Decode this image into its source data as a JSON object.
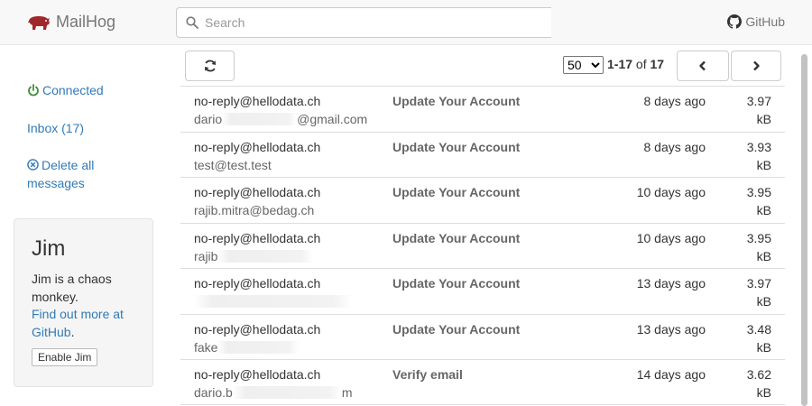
{
  "brand": {
    "name": "MailHog",
    "icon": "pig-icon",
    "color": "#a0282a"
  },
  "search": {
    "placeholder": "Search"
  },
  "header": {
    "github_label": "GitHub"
  },
  "sidebar": {
    "connected_label": "Connected",
    "inbox_label": "Inbox (17)",
    "delete_all_label": "Delete all messages",
    "jim": {
      "title": "Jim",
      "description": "Jim is a chaos monkey.",
      "link_label": "Find out more at GitHub",
      "link_suffix": ".",
      "button_label": "Enable Jim"
    }
  },
  "toolbar": {
    "per_page": "50",
    "per_page_options": [
      "50"
    ],
    "range": "1-17",
    "of": "of",
    "total": "17"
  },
  "colors": {
    "link": "#337ab7",
    "connected": "#3c8f3c",
    "border": "#dddddd"
  },
  "messages": [
    {
      "from": "no-reply@hellodata.ch",
      "to_start": "dario",
      "to_end": "@gmail.com",
      "subject": "Update Your Account",
      "date": "8 days ago",
      "size": "3.97",
      "unit": "kB"
    },
    {
      "from": "no-reply@hellodata.ch",
      "to_start": "test@test.test",
      "to_end": "",
      "subject": "Update Your Account",
      "date": "8 days ago",
      "size": "3.93",
      "unit": "kB"
    },
    {
      "from": "no-reply@hellodata.ch",
      "to_start": "rajib.mitra@bedag.ch",
      "to_end": "",
      "subject": "Update Your Account",
      "date": "10 days ago",
      "size": "3.95",
      "unit": "kB"
    },
    {
      "from": "no-reply@hellodata.ch",
      "to_start": "rajib",
      "to_end": "",
      "subject": "Update Your Account",
      "date": "10 days ago",
      "size": "3.95",
      "unit": "kB"
    },
    {
      "from": "no-reply@hellodata.ch",
      "to_start": "",
      "to_end": "",
      "subject": "Update Your Account",
      "date": "13 days ago",
      "size": "3.97",
      "unit": "kB"
    },
    {
      "from": "no-reply@hellodata.ch",
      "to_start": "fake",
      "to_end": "",
      "subject": "Update Your Account",
      "date": "13 days ago",
      "size": "3.48",
      "unit": "kB"
    },
    {
      "from": "no-reply@hellodata.ch",
      "to_start": "dario.b",
      "to_end": "m",
      "subject": "Verify email",
      "date": "14 days ago",
      "size": "3.62",
      "unit": "kB"
    }
  ]
}
